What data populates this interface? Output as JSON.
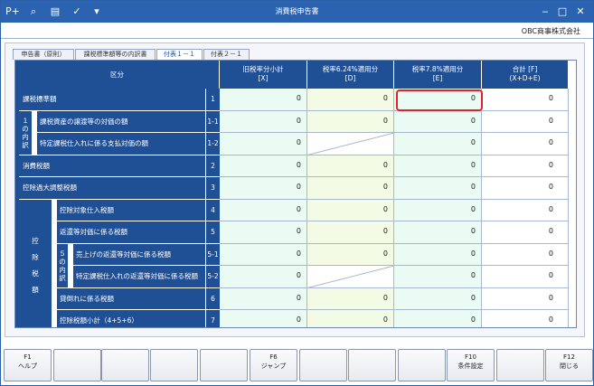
{
  "window": {
    "title": "消費税申告書",
    "company": "OBC商事株式会社"
  },
  "toolbar": {
    "icons": [
      "add-page-icon",
      "search-icon",
      "print-icon",
      "check-icon",
      "menu-arrow-icon"
    ]
  },
  "window_controls": {
    "minimize": "‒",
    "maximize": "□",
    "close": "✕"
  },
  "tabs": [
    {
      "label": "申告書（原則）"
    },
    {
      "label": "課税標準額等の内訳書"
    },
    {
      "label": "付表１－１",
      "active": true
    },
    {
      "label": "付表２－１"
    }
  ],
  "grid": {
    "headers": {
      "category": "区分",
      "c1": "旧税率分小計\n[X]",
      "c2": "税率6.24%適用分\n[D]",
      "c3": "税率7.8%適用分\n[E]",
      "c4": "合計 [F]\n(X+D+E)"
    },
    "side_labels": {
      "g1": "１\nの\n内\n訳",
      "g2": "控\n\n除\n\n税\n\n額",
      "g3": "５\nの\n内\n訳"
    },
    "rows": [
      {
        "label": "課税標準額",
        "no": "1",
        "values": [
          "0",
          "0",
          "0",
          "0"
        ]
      },
      {
        "label": "課税資産の譲渡等の対価の額",
        "no": "1-1",
        "values": [
          "0",
          "0",
          "0",
          "0"
        ]
      },
      {
        "label": "特定課税仕入れに係る支払対価の額",
        "no": "1-2",
        "values": [
          "0",
          "",
          "0",
          "0"
        ]
      },
      {
        "label": "消費税額",
        "no": "2",
        "values": [
          "0",
          "0",
          "0",
          "0"
        ]
      },
      {
        "label": "控除過大調整税額",
        "no": "3",
        "values": [
          "0",
          "0",
          "0",
          "0"
        ]
      },
      {
        "label": "控除対象仕入税額",
        "no": "4",
        "values": [
          "0",
          "0",
          "0",
          "0"
        ]
      },
      {
        "label": "返還等対価に係る税額",
        "no": "5",
        "values": [
          "0",
          "0",
          "0",
          "0"
        ]
      },
      {
        "label": "売上げの返還等対価に係る税額",
        "no": "5-1",
        "values": [
          "0",
          "0",
          "0",
          "0"
        ]
      },
      {
        "label": "特定課税仕入れの返還等対価に係る税額",
        "no": "5-2",
        "values": [
          "0",
          "",
          "0",
          "0"
        ]
      },
      {
        "label": "貸倒れに係る税額",
        "no": "6",
        "values": [
          "0",
          "0",
          "0",
          "0"
        ]
      },
      {
        "label": "控除税額小計（4+5+6）",
        "no": "7",
        "values": [
          "0",
          "0",
          "0",
          "0"
        ]
      }
    ]
  },
  "fkeys": [
    {
      "key": "F1",
      "label": "ヘルプ"
    },
    {
      "key": "",
      "label": ""
    },
    {
      "key": "",
      "label": ""
    },
    {
      "key": "",
      "label": ""
    },
    {
      "key": "",
      "label": ""
    },
    {
      "key": "F6",
      "label": "ジャンプ"
    },
    {
      "key": "",
      "label": ""
    },
    {
      "key": "",
      "label": ""
    },
    {
      "key": "",
      "label": ""
    },
    {
      "key": "F10",
      "label": "条件設定"
    },
    {
      "key": "",
      "label": ""
    },
    {
      "key": "F12",
      "label": "閉じる"
    }
  ]
}
